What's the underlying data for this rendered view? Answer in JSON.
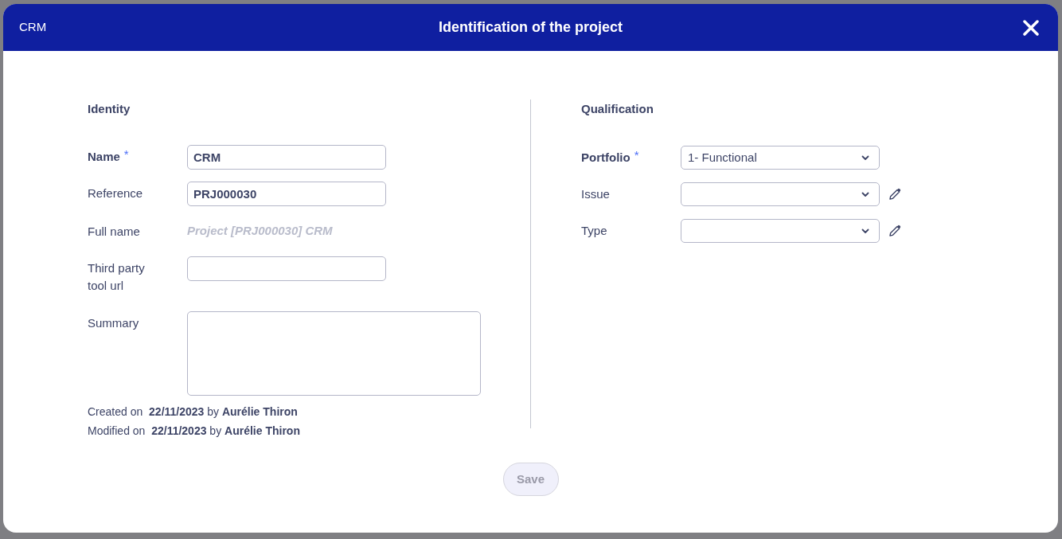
{
  "dialog": {
    "app_label": "CRM",
    "title": "Identification of the project"
  },
  "identity": {
    "heading": "Identity",
    "fields": [
      {
        "kind": "input",
        "label": "Name",
        "strong": true,
        "required_mark": "*",
        "value": "CRM"
      },
      {
        "kind": "input",
        "label": "Reference",
        "strong": false,
        "value": "PRJ000030"
      },
      {
        "kind": "computed",
        "label": "Full name",
        "strong": false,
        "value": "Project [PRJ000030] CRM"
      },
      {
        "kind": "input",
        "label": "Third party tool url",
        "strong": false
      },
      {
        "kind": "textarea",
        "label": "Summary",
        "strong": false
      }
    ],
    "audit": [
      {
        "label": "Created on",
        "date": "22/11/2023",
        "by": "by",
        "author": "Aurélie Thiron"
      },
      {
        "label": "Modified on",
        "date": "22/11/2023",
        "by": "by",
        "author": "Aurélie Thiron"
      }
    ]
  },
  "qualification": {
    "heading": "Qualification",
    "fields": [
      {
        "label": "Portfolio",
        "strong": true,
        "required_mark": "*",
        "value": "1- Functional",
        "editable": false
      },
      {
        "label": "Issue",
        "strong": false,
        "editable": true
      },
      {
        "label": "Type",
        "strong": false,
        "editable": true
      }
    ]
  },
  "save_button": {
    "label": "Save",
    "disabled": true
  }
}
